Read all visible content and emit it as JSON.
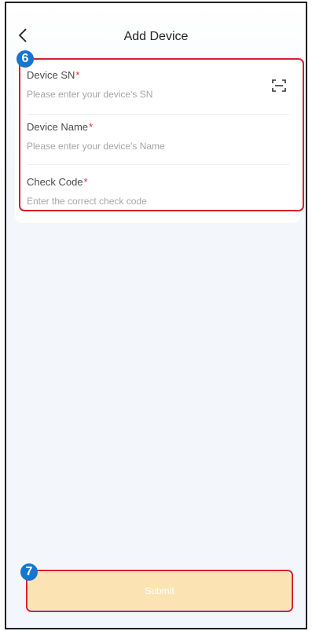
{
  "header": {
    "title": "Add Device",
    "back_icon": "chevron-left-icon"
  },
  "form": {
    "fields": [
      {
        "label": "Device SN",
        "required_mark": "*",
        "placeholder": "Please enter your device's SN",
        "value": ""
      },
      {
        "label": "Device Name",
        "required_mark": "*",
        "placeholder": "Please enter your device's Name",
        "value": ""
      },
      {
        "label": "Check Code",
        "required_mark": "*",
        "placeholder": "Enter the correct check code",
        "value": ""
      }
    ],
    "scan_icon": "scan-icon"
  },
  "submit": {
    "label": "Submit"
  },
  "annotations": {
    "form_badge": "6",
    "submit_badge": "7"
  },
  "colors": {
    "accent_badge": "#1675ce",
    "highlight_border": "#d6202b",
    "required_star": "#e1303a",
    "submit_bg": "#fbe3b3"
  }
}
